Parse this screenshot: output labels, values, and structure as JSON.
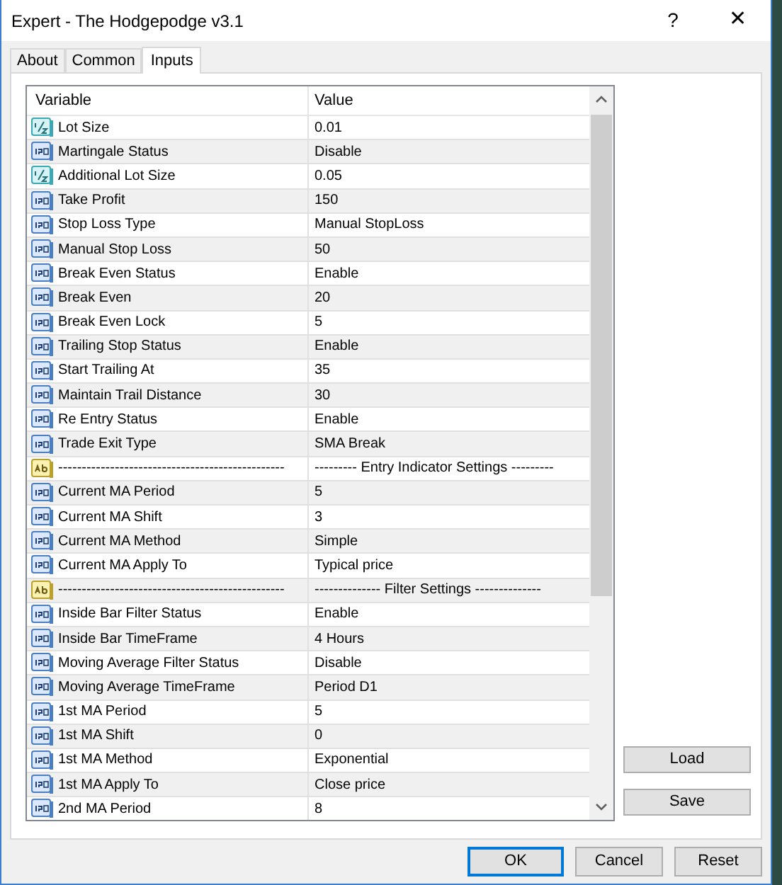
{
  "window": {
    "title": "Expert - The Hodgepodge v3.1",
    "help": "?",
    "close": "✕"
  },
  "tabs": [
    {
      "label": "About",
      "selected": false
    },
    {
      "label": "Common",
      "selected": false
    },
    {
      "label": "Inputs",
      "selected": true
    }
  ],
  "table": {
    "columns": [
      "Variable",
      "Value"
    ],
    "rows": [
      {
        "kind": "double",
        "variable": "Lot Size",
        "value": "0.01"
      },
      {
        "kind": "int",
        "variable": "Martingale Status",
        "value": "Disable"
      },
      {
        "kind": "double",
        "variable": "Additional Lot Size",
        "value": "0.05"
      },
      {
        "kind": "int",
        "variable": "Take Profit",
        "value": "150"
      },
      {
        "kind": "int",
        "variable": "Stop Loss Type",
        "value": "Manual StopLoss"
      },
      {
        "kind": "int",
        "variable": "Manual Stop Loss",
        "value": "50"
      },
      {
        "kind": "int",
        "variable": "Break Even Status",
        "value": "Enable"
      },
      {
        "kind": "int",
        "variable": "Break Even",
        "value": "20"
      },
      {
        "kind": "int",
        "variable": "Break Even Lock",
        "value": "5"
      },
      {
        "kind": "int",
        "variable": "Trailing Stop Status",
        "value": "Enable"
      },
      {
        "kind": "int",
        "variable": "Start Trailing At",
        "value": "35"
      },
      {
        "kind": "int",
        "variable": "Maintain Trail Distance",
        "value": "30"
      },
      {
        "kind": "int",
        "variable": "Re Entry Status",
        "value": "Enable"
      },
      {
        "kind": "int",
        "variable": "Trade Exit Type",
        "value": "SMA Break"
      },
      {
        "kind": "string",
        "variable": "------------------------------------------------",
        "value": "--------- Entry Indicator Settings ---------"
      },
      {
        "kind": "int",
        "variable": "Current MA Period",
        "value": "5"
      },
      {
        "kind": "int",
        "variable": "Current MA Shift",
        "value": "3"
      },
      {
        "kind": "int",
        "variable": "Current MA Method",
        "value": "Simple"
      },
      {
        "kind": "int",
        "variable": "Current MA Apply To",
        "value": "Typical price"
      },
      {
        "kind": "string",
        "variable": "------------------------------------------------",
        "value": "-------------- Filter Settings --------------"
      },
      {
        "kind": "int",
        "variable": "Inside Bar Filter Status",
        "value": "Enable"
      },
      {
        "kind": "int",
        "variable": "Inside Bar TimeFrame",
        "value": "4 Hours"
      },
      {
        "kind": "int",
        "variable": "Moving Average Filter Status",
        "value": "Disable"
      },
      {
        "kind": "int",
        "variable": "Moving Average TimeFrame",
        "value": "Period D1"
      },
      {
        "kind": "int",
        "variable": "1st MA Period",
        "value": "5"
      },
      {
        "kind": "int",
        "variable": "1st MA Shift",
        "value": "0"
      },
      {
        "kind": "int",
        "variable": "1st MA Method",
        "value": "Exponential"
      },
      {
        "kind": "int",
        "variable": "1st MA Apply To",
        "value": "Close price"
      },
      {
        "kind": "int",
        "variable": "2nd MA Period",
        "value": "8"
      }
    ]
  },
  "side_buttons": [
    "Load",
    "Save"
  ],
  "buttons": [
    {
      "label": "OK",
      "default": true
    },
    {
      "label": "Cancel",
      "default": false
    },
    {
      "label": "Reset",
      "default": false
    }
  ]
}
